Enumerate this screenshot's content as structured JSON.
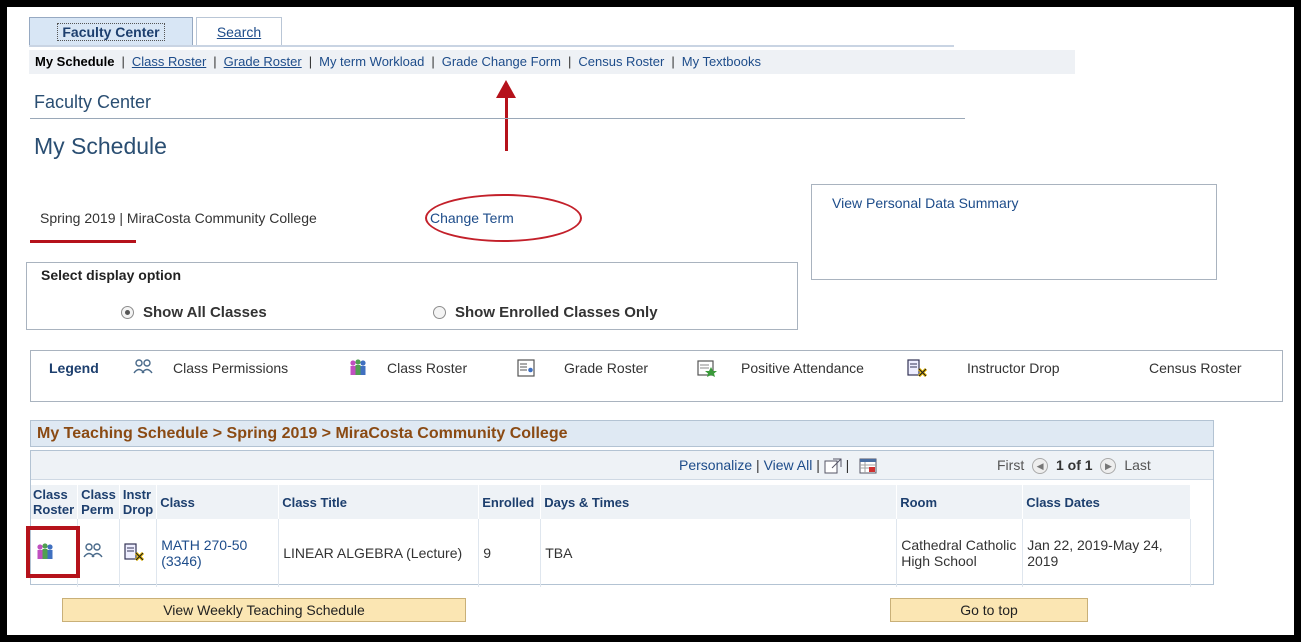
{
  "tabs": {
    "faculty_center": "Faculty Center",
    "search": "Search"
  },
  "submenu": {
    "items": [
      "My Schedule",
      "Class Roster",
      "Grade Roster",
      "My term Workload",
      "Grade Change Form",
      "Census Roster",
      "My Textbooks"
    ],
    "sep": "|"
  },
  "page": {
    "crumb_title": "Faculty Center",
    "schedule_title": "My Schedule"
  },
  "term": {
    "label": "Spring 2019 | MiraCosta Community College",
    "change_term": "Change Term"
  },
  "personal": {
    "link": "View Personal Data Summary"
  },
  "display_option": {
    "title": "Select display option",
    "all": "Show All Classes",
    "enrolled": "Show Enrolled Classes Only",
    "selected": "all"
  },
  "legend": {
    "title": "Legend",
    "class_permissions": "Class Permissions",
    "class_roster": "Class Roster",
    "grade_roster": "Grade Roster",
    "positive_attendance": "Positive Attendance",
    "instructor_drop": "Instructor Drop",
    "census_roster": "Census Roster"
  },
  "grid": {
    "header": "My Teaching Schedule > Spring 2019 > MiraCosta Community College",
    "personalize": "Personalize",
    "view_all": "View All",
    "sep": "|",
    "first": "First",
    "page": "1 of 1",
    "last": "Last",
    "columns": {
      "class_roster": "Class Roster",
      "class_perm": "Class Perm",
      "instr_drop": "Instr Drop",
      "class": "Class",
      "class_title": "Class Title",
      "enrolled": "Enrolled",
      "days_times": "Days & Times",
      "room": "Room",
      "class_dates": "Class Dates"
    },
    "row": {
      "class": "MATH 270-50 (3346)",
      "class_title": "LINEAR ALGEBRA (Lecture)",
      "enrolled": "9",
      "days_times": "TBA",
      "room": "Cathedral Catholic High School",
      "class_dates": "Jan 22, 2019-May 24, 2019"
    }
  },
  "buttons": {
    "weekly": "View Weekly Teaching Schedule",
    "top": "Go to top"
  },
  "colors": {
    "accent_red": "#b5121b",
    "link_blue": "#1d4c8a",
    "header_brown": "#8a4a13",
    "button_bg": "#fbe6b3"
  }
}
